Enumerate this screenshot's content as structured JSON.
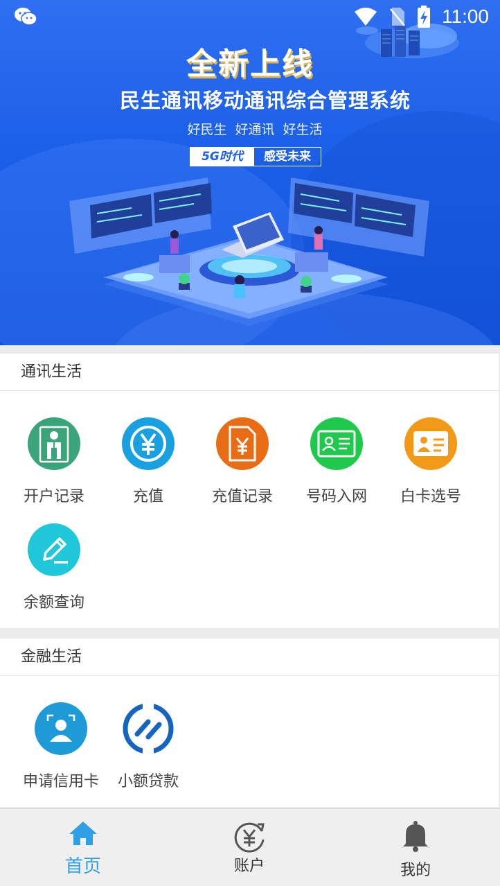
{
  "status_bar": {
    "time": "11:00",
    "icons": [
      "wechat-icon",
      "wifi-icon",
      "no-sim-icon",
      "battery-charging-icon"
    ]
  },
  "banner": {
    "title": "全新上线",
    "subtitle": "民生通讯移动通讯综合管理系统",
    "slogan": "好民生 好通讯 好生活",
    "tag_left": "5G时代",
    "tag_right": "感受未来"
  },
  "telecom": {
    "header": "通讯生活",
    "items": [
      {
        "label": "开户记录",
        "icon": "account-record-icon",
        "color": "#3aa57a"
      },
      {
        "label": "充值",
        "icon": "yen-icon",
        "color": "#18a0e0"
      },
      {
        "label": "充值记录",
        "icon": "yen-document-icon",
        "color": "#e86c14"
      },
      {
        "label": "号码入网",
        "icon": "id-card-icon",
        "color": "#1ec94c"
      },
      {
        "label": "白卡选号",
        "icon": "badge-card-icon",
        "color": "#f29a18"
      },
      {
        "label": "余额查询",
        "icon": "pen-edit-icon",
        "color": "#1fc7d8"
      }
    ]
  },
  "finance": {
    "header": "金融生活",
    "items": [
      {
        "label": "申请信用卡",
        "icon": "user-profile-icon",
        "color": "#1e9ad6"
      },
      {
        "label": "小额贷款",
        "icon": "loan-logo-icon",
        "color": "#1565c0"
      }
    ]
  },
  "bottom_nav": {
    "items": [
      {
        "label": "首页",
        "icon": "home-icon",
        "active": true
      },
      {
        "label": "账户",
        "icon": "yen-refresh-icon",
        "active": false
      },
      {
        "label": "我的",
        "icon": "bell-icon",
        "active": false
      }
    ],
    "active_color": "#2fa0e6"
  }
}
